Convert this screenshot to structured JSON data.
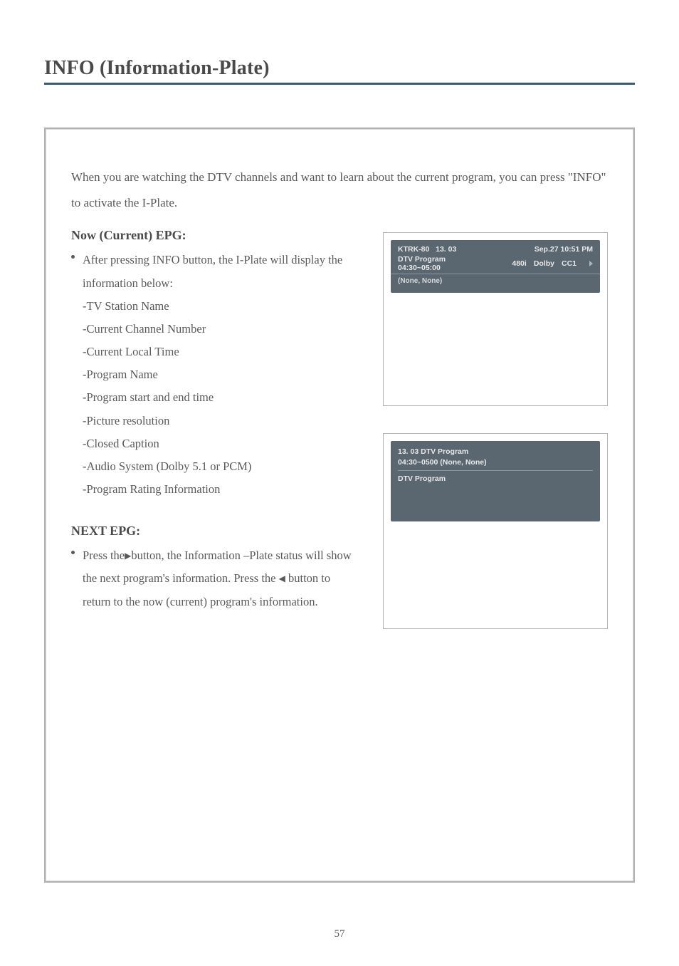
{
  "title": "INFO (Information-Plate)",
  "intro": "When you are watching the DTV channels and want to learn about the current program, you can press \"INFO\" to activate the I-Plate.",
  "now": {
    "heading": "Now (Current) EPG:",
    "bullet_lead": "After pressing INFO button, the I-Plate will display the information below:",
    "items": [
      "-TV Station Name",
      "-Current Channel Number",
      "-Current Local Time",
      "-Program Name",
      "-Program start and end time",
      "-Picture resolution",
      "-Closed Caption",
      "-Audio System (Dolby 5.1 or PCM)",
      "-Program Rating Information"
    ]
  },
  "next": {
    "heading": "NEXT EPG:",
    "para_pre": "Press the",
    "para_mid1": "button, the Information –Plate status will show the next program's information. Press the ",
    "para_mid2": " button to return to the now (current) program's information."
  },
  "osd1": {
    "station": "KTRK-80",
    "channel": "13. 03",
    "datetime": "Sep.27  10:51  PM",
    "program": "DTV Program",
    "time_range": "04:30~05:00",
    "res": "480i",
    "audio": "Dolby",
    "cc": "CC1",
    "rating": "(None, None)"
  },
  "osd2": {
    "line1a": "13. 03   DTV Program",
    "line1b": "04:30~0500 (None, None)",
    "line2": "DTV Program"
  },
  "page_number": "57"
}
